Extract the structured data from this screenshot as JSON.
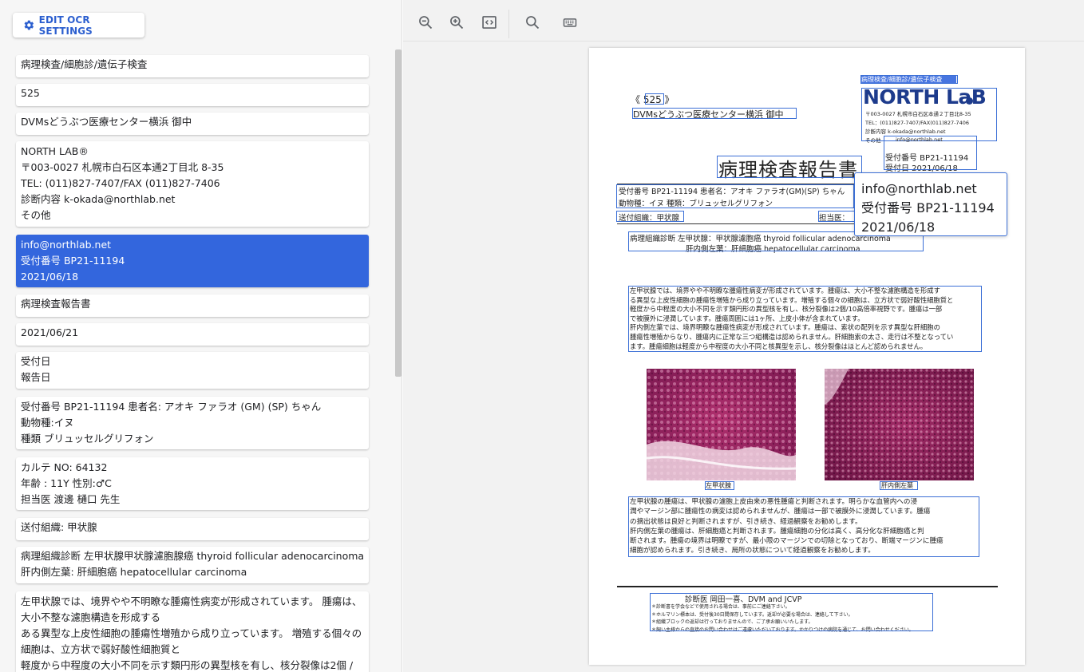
{
  "left_panel": {
    "edit_button": "EDIT OCR SETTINGS",
    "cards": [
      {
        "lines": [
          "病理検査/細胞診/遺伝子検査"
        ]
      },
      {
        "lines": [
          "525"
        ]
      },
      {
        "lines": [
          "DVMsどうぶつ医療センター横浜 御中"
        ]
      },
      {
        "lines": [
          "NORTH LAB®",
          "〒003-0027 札幌市白石区本通2丁目北 8-35",
          "TEL: (011)827-7407/FAX (011)827-7406",
          "診断内容 k-okada@northlab.net",
          "その他"
        ]
      },
      {
        "lines": [
          "info@northlab.net",
          "受付番号 BP21-11194",
          "2021/06/18"
        ],
        "selected": true
      },
      {
        "lines": [
          "病理検査報告書"
        ]
      },
      {
        "lines": [
          "2021/06/21"
        ]
      },
      {
        "lines": [
          "受付日",
          "報告日"
        ]
      },
      {
        "lines": [
          "受付番号 BP21-11194 患者名: アオキ ファラオ (GM) (SP) ちゃん",
          "動物種:イヌ",
          "種類 ブリュッセルグリフォン"
        ]
      },
      {
        "lines": [
          "カルテ NO: 64132",
          "年齢 : 11Y 性別:♂C",
          "担当医 渡邊 樋口 先生"
        ]
      },
      {
        "lines": [
          "送付組織: 甲状腺"
        ]
      },
      {
        "lines": [
          "病理組織診断 左甲状腺甲状腺濾胞腺癌 thyroid follicular adenocarcinoma",
          "肝内側左葉: 肝細胞癌 hepatocellular carcinoma"
        ]
      },
      {
        "lines": [
          "左甲状腺では、境界やや不明瞭な腫瘍性病変が形成されています。 腫瘍は、大小不整な濾胞構造を形成する",
          "ある異型な上皮性細胞の腫瘍性増殖から成り立っています。 増殖する個々の細胞は、立方状で弱好酸性細胞質と",
          "軽度から中程度の大小不同を示す類円形の異型核を有し、核分裂像は2個 /"
        ]
      }
    ]
  },
  "toolbar": {
    "buttons": [
      "zoom-out-icon",
      "zoom-in-icon",
      "fit-code-icon",
      "search-icon",
      "keyboard-icon"
    ]
  },
  "document": {
    "header_category": "病理検査/細胞診/遺伝子検査",
    "number": "《 525 》",
    "recipient": "DVMsどうぶつ医療センター横浜 御中",
    "logo": "NORTH LaB",
    "lab_address": "〒003-0027 札幌市白石区本通２丁目北8-35",
    "lab_tel": "TEL：(011)827-7407/FAX(011)827-7406",
    "lab_diag": "診断内容 k-okada@northlab.net",
    "lab_other": "その他",
    "lab_email": "info@northlab.net",
    "receipt_label": "受付番号 BP21-11194",
    "receipt_date": "受付日 2021/06/18",
    "title": "病理検査報告書",
    "patient_line": "受付番号 BP21-11194 患者名：アオキ ファラオ(GM)(SP) ちゃん",
    "species_line": "動物種：イヌ 種類：ブリュッセルグリフォン",
    "tissue_line": "送付組織：甲状腺",
    "doctor_label": "担当医：",
    "diag1": "病理組織診断 左甲状腺：甲状腺濾胞癌 thyroid follicular adenocarcinoma",
    "diag2": "肝内側左葉：肝細胞癌 hepatocellular carcinoma",
    "body1": [
      "左甲状腺では、境界やや不明瞭な腫瘍性病変が形成されています。腫瘍は、大小不整な濾胞構造を形成す",
      "る異型な上皮性細胞の腫瘍性増殖から成り立っています。増殖する個々の細胞は、立方状で弱好酸性細胞質と",
      "軽度から中程度の大小不同を示す類円形の異型核を有し、核分裂像は2個/10高倍率視野です。腫瘍は一部",
      "で被膜外に浸潤しています。腫瘍周囲には1ヶ所、上皮小体が含まれています。",
      "肝内側左葉では、境界明瞭な腫瘍性病変が形成されています。腫瘍は、索状の配列を示す異型な肝細胞の",
      "腫瘍性増殖からなり、腫瘍内に正常な三つ組構造は認められません。肝細胞索の太さ、走行は不整となってい",
      "ます。腫瘍細胞は軽度から中程度の大小不同と核異型を示し、核分裂像はほとんど認められません。"
    ],
    "caption1": "左甲状腺",
    "caption2": "肝内側左葉",
    "body2": [
      "左甲状腺の腫瘍は、甲状腺の濾胞上皮由来の悪性腫瘍と判断されます。明らかな血管内への浸",
      "潤やマージン部に腫瘍性の病変は認められませんが、腫瘍は一部で被膜外に浸潤しています。腫瘍",
      "の摘出状態は良好と判断されますが、引き続き、経過観察をお勧めします。",
      "肝内側左葉の腫瘍は、肝細胞癌と判断されます。腫瘍細胞の分化は高く、高分化な肝細胞癌と判",
      "断されます。腫瘍の境界は明瞭ですが、最小限のマージンでの切除となっており、断端マージンに腫瘍",
      "細胞が認められます。引き続き、局所の状態について経過観察をお勧めします。"
    ],
    "signer": "診断医 岡田一喜、DVM and JCVP",
    "notes": [
      "＊診断書を学会などで使用される場合は、事前にご連絡下さい。",
      "＊ホルマリン標本は、受付後30日間保存しています。返却が必要な場合は、連絡して下さい。",
      "＊組織ブロックの返却は行っておりませんので、ご了承お願いいたします。",
      "＊飼い主様からの直接のお問い合わせはご遠慮いただいております。かかりつけの病院を通じて、お問い合わせください。"
    ]
  },
  "tooltip": {
    "lines": [
      "info@northlab.net",
      "受付番号 BP21-11194",
      "2021/06/18"
    ]
  }
}
